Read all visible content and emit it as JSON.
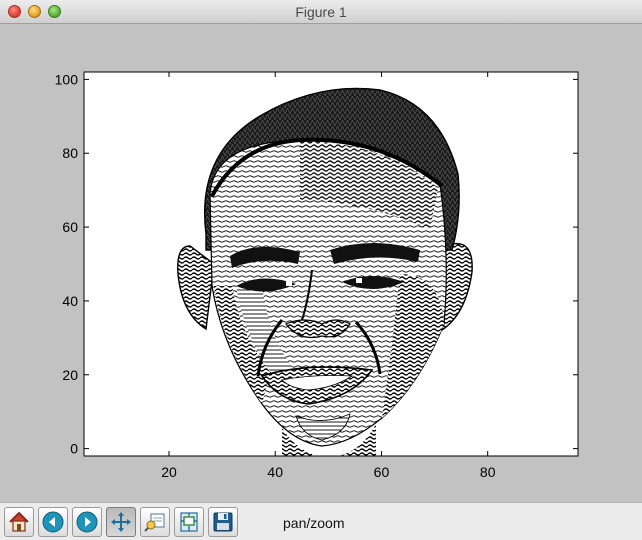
{
  "window": {
    "title": "Figure 1",
    "controls": [
      "close",
      "minimize",
      "zoom"
    ]
  },
  "chart_data": {
    "type": "scatter",
    "title": "",
    "xlabel": "",
    "ylabel": "",
    "xlim": [
      4,
      97
    ],
    "ylim": [
      -2,
      102
    ],
    "xticks": [
      20,
      40,
      60,
      80
    ],
    "yticks": [
      0,
      20,
      40,
      60,
      80,
      100
    ],
    "grid": false,
    "marker": "wavy line strokes forming a halftone portrait of a face",
    "colors": {
      "ink": "#000000",
      "face_background": "#ffffff",
      "figure_background": "#c2c2c2"
    }
  },
  "toolbar": {
    "buttons": [
      {
        "name": "home",
        "icon": "home-icon"
      },
      {
        "name": "back",
        "icon": "back-arrow-icon"
      },
      {
        "name": "forward",
        "icon": "forward-arrow-icon"
      },
      {
        "name": "pan",
        "icon": "pan-move-icon",
        "active": true
      },
      {
        "name": "zoom-rect",
        "icon": "zoom-to-rect-icon"
      },
      {
        "name": "subplots",
        "icon": "configure-subplots-icon"
      },
      {
        "name": "save",
        "icon": "save-icon"
      }
    ],
    "status": "pan/zoom"
  }
}
